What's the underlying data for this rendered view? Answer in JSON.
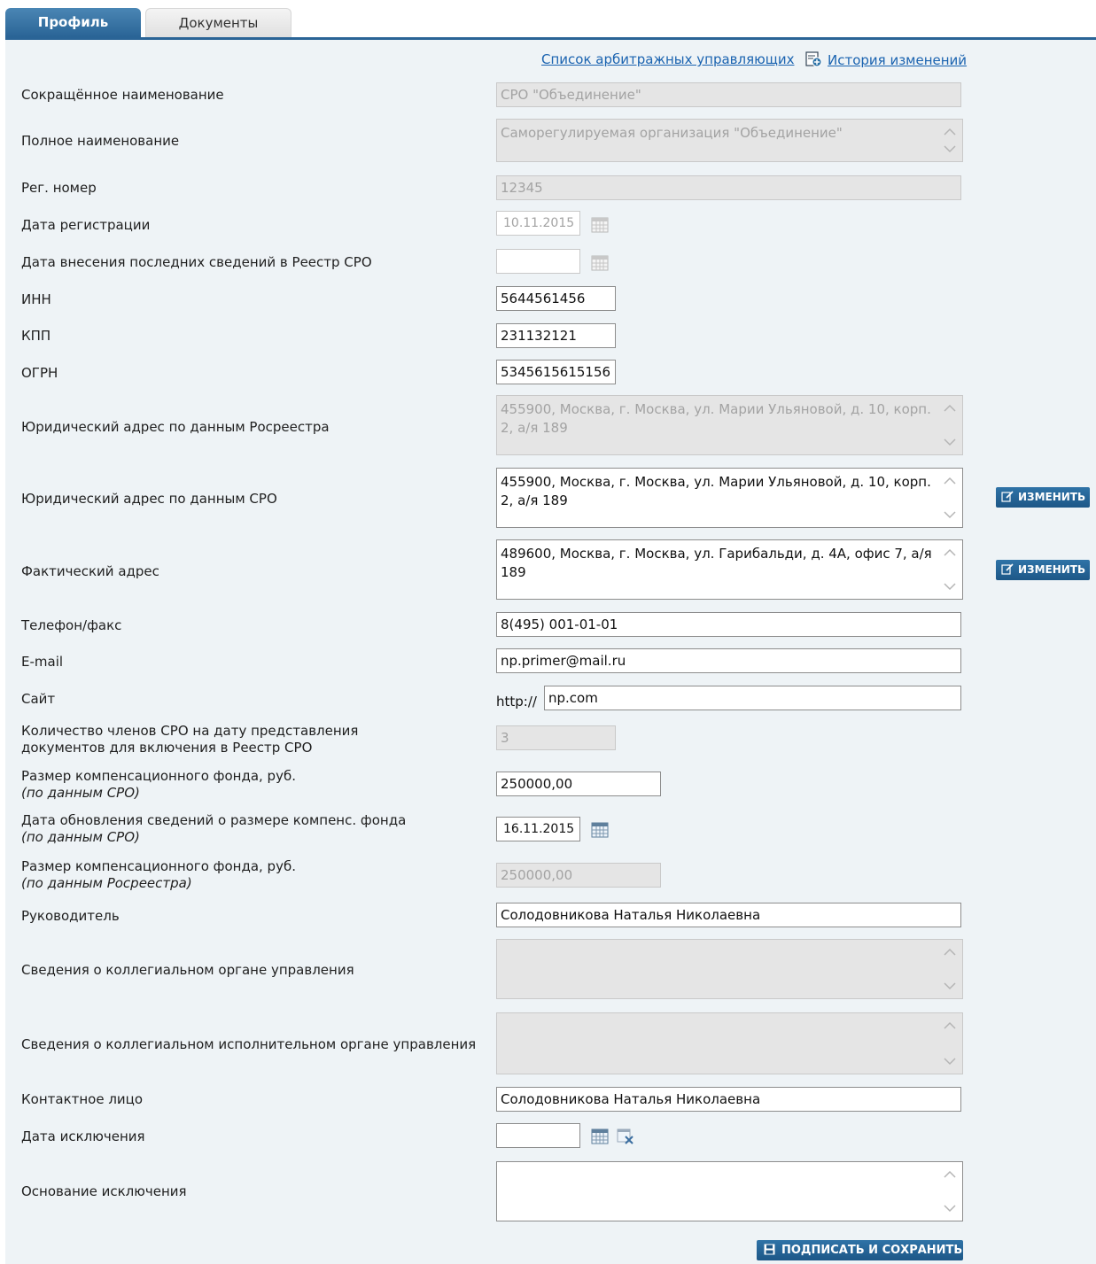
{
  "tabs": [
    {
      "label": "Профиль",
      "active": true
    },
    {
      "label": "Документы",
      "active": false
    }
  ],
  "links": {
    "arbitration_list": "Список арбитражных управляющих",
    "history": "История изменений"
  },
  "fields": {
    "short_name": {
      "label": "Сокращённое наименование",
      "value": "СРО \"Объединение\""
    },
    "full_name": {
      "label": "Полное наименование",
      "value": "Саморегулируемая организация \"Объединение\""
    },
    "reg_number": {
      "label": "Рег. номер",
      "value": "12345"
    },
    "reg_date": {
      "label": "Дата регистрации",
      "value": "10.11.2015"
    },
    "last_entry_date": {
      "label": "Дата внесения последних сведений в Реестр СРО",
      "value": ""
    },
    "inn": {
      "label": "ИНН",
      "value": "5644561456"
    },
    "kpp": {
      "label": "КПП",
      "value": "231132121"
    },
    "ogrn": {
      "label": "ОГРН",
      "value": "5345615615156"
    },
    "legal_address_rosreestr": {
      "label": "Юридический адрес по данным Росреестра",
      "value": "455900, Москва, г. Москва, ул. Марии Ульяновой, д. 10, корп. 2, а/я 189"
    },
    "legal_address_sro": {
      "label": "Юридический адрес по данным СРО",
      "value": "455900, Москва, г. Москва, ул. Марии Ульяновой, д. 10, корп. 2, а/я 189"
    },
    "actual_address": {
      "label": "Фактический адрес",
      "value": "489600, Москва, г. Москва, ул. Гарибальди, д. 4А, офис 7, а/я 189"
    },
    "phone": {
      "label": "Телефон/факс",
      "value": "8(495) 001-01-01"
    },
    "email": {
      "label": "E-mail",
      "value": "np.primer@mail.ru"
    },
    "site": {
      "label": "Сайт",
      "prefix": "http://",
      "value": "np.com"
    },
    "members_count": {
      "label_line1": "Количество членов СРО на дату представления",
      "label_line2": "документов для включения в Реестр СРО",
      "value": "3"
    },
    "comp_fund_sro": {
      "label": "Размер компенсационного фонда, руб.",
      "sub": "(по данным СРО)",
      "value": "250000,00"
    },
    "comp_fund_date": {
      "label": "Дата обновления сведений о размере компенс. фонда",
      "sub": "(по данным СРО)",
      "value": "16.11.2015"
    },
    "comp_fund_rosreestr": {
      "label": "Размер компенсационного фонда, руб.",
      "sub": "(по данным Росреестра)",
      "value": "250000,00"
    },
    "head": {
      "label": "Руководитель",
      "value": "Солодовникова Наталья Николаевна"
    },
    "collegial_body": {
      "label": "Сведения о коллегиальном органе управления",
      "value": ""
    },
    "collegial_exec_body": {
      "label": "Сведения о коллегиальном исполнительном органе управления",
      "value": ""
    },
    "contact_person": {
      "label": "Контактное лицо",
      "value": "Солодовникова Наталья Николаевна"
    },
    "exclusion_date": {
      "label": "Дата исключения",
      "value": ""
    },
    "exclusion_reason": {
      "label": "Основание исключения",
      "value": ""
    }
  },
  "buttons": {
    "edit": "ИЗМЕНИТЬ",
    "sign_save": "ПОДПИСАТЬ И СОХРАНИТЬ"
  },
  "colors": {
    "accent": "#2a6496",
    "panel_bg": "#eef3f6",
    "link": "#1a63b0",
    "readonly_bg": "#e5e5e5"
  }
}
